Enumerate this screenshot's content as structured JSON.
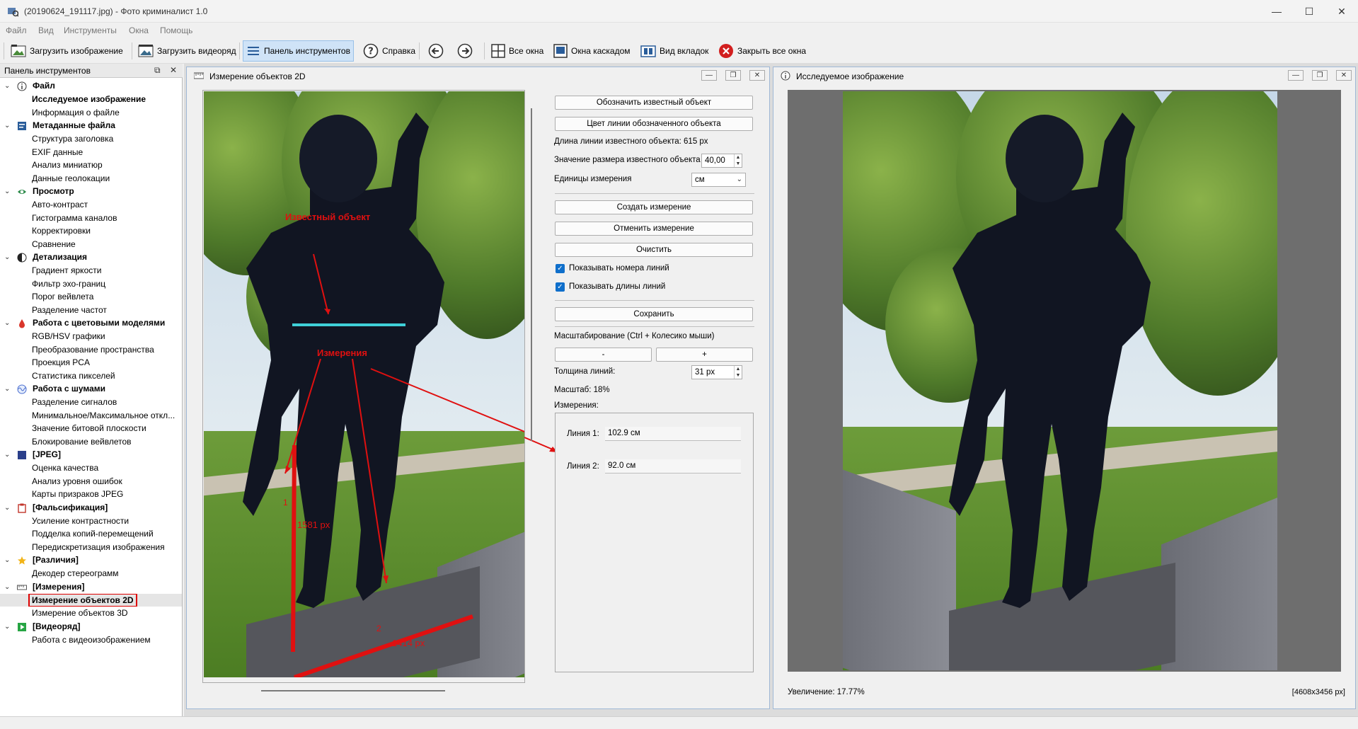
{
  "window": {
    "title": "(20190624_191117.jpg) - Фото криминалист 1.0",
    "minimize": "—",
    "maximize": "☐",
    "close": "✕"
  },
  "menu": [
    "Файл",
    "Вид",
    "Инструменты",
    "Окна",
    "Помощь"
  ],
  "toolbar": {
    "load_image": "Загрузить изображение",
    "load_video": "Загрузить видеоряд",
    "tools_panel": "Панель инструментов",
    "help": "Справка",
    "all_windows": "Все окна",
    "cascade": "Окна каскадом",
    "tabs_view": "Вид вкладок",
    "close_all": "Закрыть все окна"
  },
  "panel": {
    "title": "Панель инструментов",
    "groups": [
      {
        "label": "Файл",
        "icon": "info-icon",
        "items": [
          "Исследуемое изображение",
          "Информация о файле"
        ]
      },
      {
        "label": "Метаданные файла",
        "icon": "metadata-icon",
        "items": [
          "Структура заголовка",
          "EXIF данные",
          "Анализ миниатюр",
          "Данные геолокации"
        ]
      },
      {
        "label": "Просмотр",
        "icon": "eye-icon",
        "items": [
          "Авто-контраст",
          "Гистограмма каналов",
          "Корректировки",
          "Сравнение"
        ]
      },
      {
        "label": "Детализация",
        "icon": "contrast-icon",
        "items": [
          "Градиент яркости",
          "Фильтр эхо-границ",
          "Порог вейвлета",
          "Разделение частот"
        ]
      },
      {
        "label": "Работа с цветовыми моделями",
        "icon": "drop-icon",
        "items": [
          "RGB/HSV графики",
          "Преобразование пространства",
          "Проекция PCA",
          "Статистика пикселей"
        ]
      },
      {
        "label": "Работа с шумами",
        "icon": "noise-icon",
        "items": [
          "Разделение сигналов",
          "Минимальное/Максимальное откл...",
          "Значение битовой плоскости",
          "Блокирование вейвлетов"
        ]
      },
      {
        "label": "[JPEG]",
        "icon": "jpeg-icon",
        "items": [
          "Оценка качества",
          "Анализ уровня ошибок",
          "Карты призраков JPEG"
        ]
      },
      {
        "label": "[Фальсификация]",
        "icon": "clipboard-icon",
        "items": [
          "Усиление контрастности",
          "Подделка копий-перемещений",
          "Передискретизация изображения"
        ]
      },
      {
        "label": "[Различия]",
        "icon": "star-icon",
        "items": [
          "Декодер стереограмм"
        ]
      },
      {
        "label": "[Измерения]",
        "icon": "ruler-icon",
        "items": [
          "Измерение объектов 2D",
          "Измерение объектов 3D"
        ]
      },
      {
        "label": "[Видеоряд]",
        "icon": "play-icon",
        "items": [
          "Работа с видеоизображением"
        ]
      }
    ]
  },
  "measure_window": {
    "title": "Измерение объектов 2D",
    "annotations": {
      "known_object": "Известный объект",
      "measurements": "Измерения",
      "line1_length": "1581 px",
      "line2_length": "1414 px",
      "line1_number": "1",
      "line2_number": "2"
    },
    "controls": {
      "mark_known": "Обозначить известный объект",
      "line_color": "Цвет линии обозначенного объекта",
      "known_length": "Длина линии известного объекта: 615 px",
      "known_size_label": "Значение размера известного объекта",
      "known_size_value": "40,00",
      "units_label": "Единицы измерения",
      "units_value": "см",
      "create": "Создать измерение",
      "undo": "Отменить измерение",
      "clear": "Очистить",
      "show_numbers": "Показывать номера линий",
      "show_lengths": "Показывать длины линий",
      "save": "Сохранить",
      "zoom_label": "Масштабирование (Ctrl + Колесико мыши)",
      "zoom_minus": "-",
      "zoom_plus": "+",
      "thickness_label": "Толщина линий:",
      "thickness_value": "31 px",
      "scale": "Масштаб: 18%",
      "measurements_label": "Измерения:",
      "lines": [
        {
          "label": "Линия 1:",
          "value": "102.9 см"
        },
        {
          "label": "Линия 2:",
          "value": "92.0 см"
        }
      ]
    }
  },
  "image_window": {
    "title": "Исследуемое изображение",
    "zoom": "Увеличение:  17.77%",
    "dimensions": "[4608x3456 px]"
  },
  "colors": {
    "annotation_red": "#e01010",
    "known_line": "#3fd0d8",
    "selection_outline": "#d00000"
  }
}
